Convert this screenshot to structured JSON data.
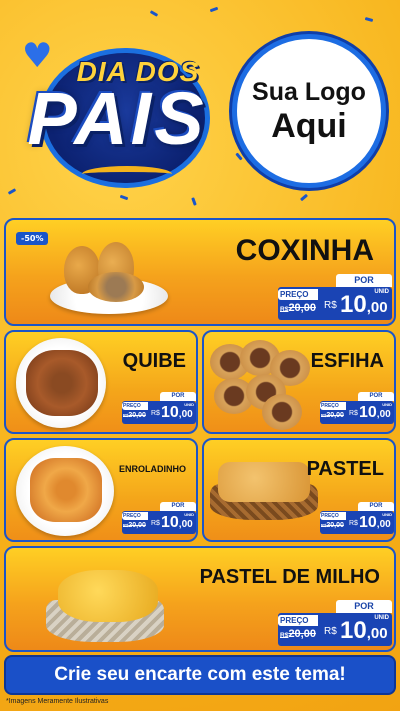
{
  "header": {
    "title_top": "DIA DOS",
    "title_main": "PAIS",
    "logo_line1": "Sua Logo",
    "logo_line2": "Aqui"
  },
  "colors": {
    "background": "#f6b91f",
    "accent_blue": "#1a44b4",
    "card_orange": "#f4a51a"
  },
  "price_labels": {
    "por": "POR",
    "preco": "PREÇO",
    "currency": "R$",
    "unit": "UNID"
  },
  "products": [
    {
      "name": "COXINHA",
      "discount": "-50%",
      "old_prefix": "R$",
      "old_price": "20,00",
      "price_int": "10",
      "price_dec": ",00"
    },
    {
      "name": "QUIBE",
      "old_prefix": "R$",
      "old_price": "20,00",
      "price_int": "10",
      "price_dec": ",00"
    },
    {
      "name": "ESFIHA",
      "old_prefix": "R$",
      "old_price": "20,00",
      "price_int": "10",
      "price_dec": ",00"
    },
    {
      "name": "ENROLADINHO",
      "old_prefix": "R$",
      "old_price": "20,00",
      "price_int": "10",
      "price_dec": ",00"
    },
    {
      "name": "PASTEL",
      "old_prefix": "R$",
      "old_price": "20,00",
      "price_int": "10",
      "price_dec": ",00"
    },
    {
      "name": "PASTEL DE MILHO",
      "old_prefix": "R$",
      "old_price": "20,00",
      "price_int": "10",
      "price_dec": ",00"
    }
  ],
  "cta": {
    "label": "Crie seu encarte com este tema!"
  },
  "footnote": "*Imagens Meramente Ilustrativas"
}
